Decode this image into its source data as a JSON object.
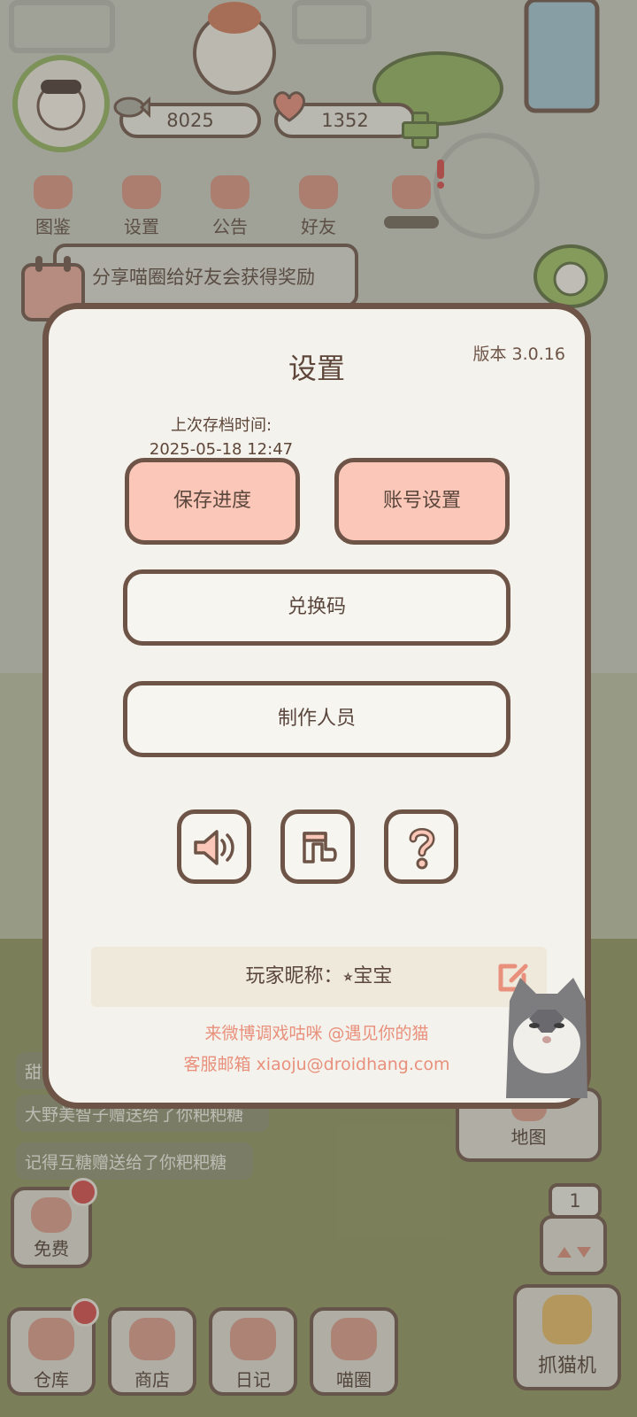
{
  "hud": {
    "currency_1": "8025",
    "currency_2": "1352"
  },
  "top_menu": [
    {
      "label": "图鉴"
    },
    {
      "label": "设置"
    },
    {
      "label": "公告"
    },
    {
      "label": "好友"
    }
  ],
  "banner_text": "分享喵圈给好友会获得奖励",
  "messages": [
    "甜",
    "大野美智子赠送给了你粑粑糖",
    "记得互糖赠送给了你粑粑糖"
  ],
  "dialog": {
    "title": "设置",
    "version": "版本 3.0.16",
    "last_save_label": "上次存档时间:",
    "last_save_time": "2025-05-18 12:47",
    "save_button": "保存进度",
    "account_button": "账号设置",
    "redeem_button": "兑换码",
    "credits_button": "制作人员",
    "nickname": "玩家昵称：⭒宝宝",
    "weibo_text": "来微博调戏咕咪 @遇见你的猫",
    "email_text": "客服邮箱 xiaoju@droidhang.com"
  },
  "side": {
    "map_label": "地图",
    "claw_count": "1",
    "claw_label": "抓猫机"
  },
  "bottom_bar": {
    "free_label": "免费",
    "warehouse_label": "仓库",
    "shop_label": "商店",
    "diary_label": "日记",
    "circle_label": "喵圈"
  },
  "colors": {
    "accent_pink": "#fbc7b8",
    "border_brown": "#6d5447",
    "footer_text": "#e9907c"
  }
}
